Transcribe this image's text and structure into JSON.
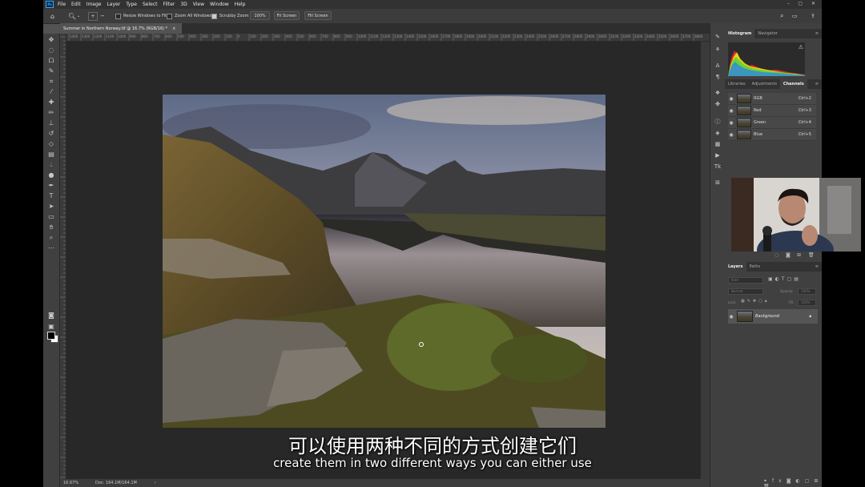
{
  "menu": [
    "File",
    "Edit",
    "Image",
    "Layer",
    "Type",
    "Select",
    "Filter",
    "3D",
    "View",
    "Window",
    "Help"
  ],
  "options": {
    "resize_windows": "Resize Windows to Fit",
    "zoom_all": "Zoom All Windows",
    "scrubby_zoom": "Scrubby Zoom",
    "zoom_value": "100%",
    "fit_screen": "Fit Screen",
    "fill_screen": "Fill Screen"
  },
  "document": {
    "tab_title": "Summer in Northern Norway.tif @ 16.7% (RGB/16) *",
    "zoom": "16.67%",
    "doc_size": "Doc: 164.1M/164.1M"
  },
  "ruler_ticks": [
    "1400",
    "1300",
    "1200",
    "1100",
    "1000",
    "900",
    "800",
    "700",
    "600",
    "500",
    "400",
    "300",
    "200",
    "100",
    "0",
    "100",
    "200",
    "300",
    "400",
    "500",
    "600",
    "700",
    "800",
    "900",
    "1000",
    "1100",
    "1200",
    "1300",
    "1400",
    "1500",
    "1600",
    "1700",
    "1800",
    "1900",
    "2000",
    "2100",
    "2200",
    "2300",
    "2400",
    "2500",
    "2600",
    "2700",
    "2800",
    "2900",
    "3000",
    "3100",
    "3200",
    "3300",
    "3400",
    "3500",
    "3600",
    "3700",
    "3800"
  ],
  "panels": {
    "top_tabs": [
      "Histogram",
      "Navigator"
    ],
    "mid_tabs": [
      "Libraries",
      "Adjustments",
      "Channels"
    ],
    "channels": [
      {
        "name": "RGB",
        "key": "Ctrl+2"
      },
      {
        "name": "Red",
        "key": "Ctrl+3"
      },
      {
        "name": "Green",
        "key": "Ctrl+4"
      },
      {
        "name": "Blue",
        "key": "Ctrl+5"
      }
    ],
    "layer_tabs": [
      "Layers",
      "Paths"
    ],
    "layer_search": "Kind",
    "blend_mode": "Normal",
    "opacity_label": "Opacity:",
    "opacity_value": "100%",
    "lock_label": "Lock:",
    "fill_label": "Fill:",
    "fill_value": "100%",
    "layers": [
      {
        "name": "Background"
      }
    ]
  },
  "subtitles": {
    "zh": "可以使用两种不同的方式创建它们",
    "en": "create them in two different ways you can either use"
  },
  "colors": {
    "app_bg": "#535353",
    "panel_bg": "#404040",
    "accent": "#31a8ff"
  }
}
